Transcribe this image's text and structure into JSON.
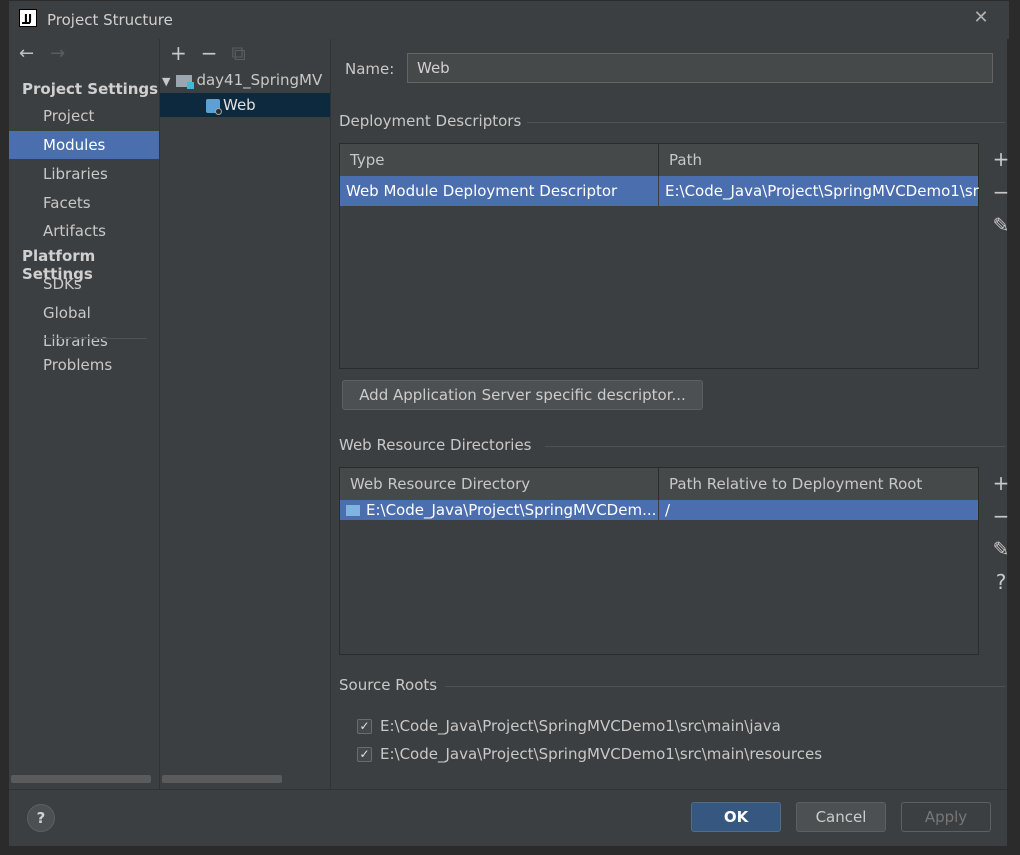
{
  "window": {
    "title": "Project Structure",
    "app_icon_text": "IJ",
    "close_glyph": "✕"
  },
  "nav": {
    "back_glyph": "←",
    "forward_glyph": "→",
    "project_settings_title": "Project Settings",
    "project_settings_items": [
      "Project",
      "Modules",
      "Libraries",
      "Facets",
      "Artifacts"
    ],
    "platform_settings_title": "Platform Settings",
    "platform_settings_items": [
      "SDKs",
      "Global Libraries"
    ],
    "problems": "Problems",
    "selected": "Modules"
  },
  "tree": {
    "add": "+",
    "remove": "−",
    "copy": "⧉",
    "root": "day41_SpringMV",
    "child": "Web"
  },
  "facet": {
    "name_label": "Name:",
    "name_value": "Web",
    "deployment_title": "Deployment Descriptors",
    "deployment_columns": [
      "Type",
      "Path"
    ],
    "deployment_row": [
      "Web Module Deployment Descriptor",
      "E:\\Code_Java\\Project\\SpringMVCDemo1\\sr"
    ],
    "add_server_descriptor": "Add Application Server specific descriptor...",
    "resources_title": "Web Resource Directories",
    "resources_columns": [
      "Web Resource Directory",
      "Path Relative to Deployment Root"
    ],
    "resources_row": [
      "E:\\Code_Java\\Project\\SpringMVCDem...",
      "/"
    ],
    "source_roots_title": "Source Roots",
    "source_roots": [
      {
        "path": "E:\\Code_Java\\Project\\SpringMVCDemo1\\src\\main\\java",
        "checked": true
      },
      {
        "path": "E:\\Code_Java\\Project\\SpringMVCDemo1\\src\\main\\resources",
        "checked": true
      }
    ],
    "tool_add": "+",
    "tool_remove": "−",
    "tool_edit": "✎",
    "tool_help": "?"
  },
  "footer": {
    "help": "?",
    "ok": "OK",
    "cancel": "Cancel",
    "apply": "Apply"
  },
  "colors": {
    "selection": "#4b6eaf",
    "background": "#3c3f41",
    "primary_button": "#365880"
  }
}
